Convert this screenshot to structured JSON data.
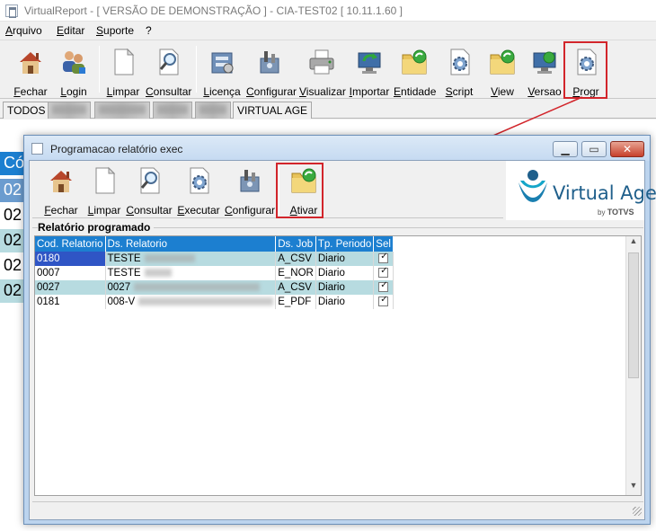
{
  "window": {
    "title": "VirtualReport - [ VERSÃO DE DEMONSTRAÇÃO ] - CIA-TEST02 [ 10.11.1.60 ]"
  },
  "menu": [
    "Arquivo",
    "Editar",
    "Suporte",
    "?"
  ],
  "toolbar": [
    {
      "label": "Fechar",
      "icon": "house-icon"
    },
    {
      "label": "Login",
      "icon": "users-icon"
    },
    {
      "label": "Limpar",
      "icon": "blank-page-icon"
    },
    {
      "label": "Consultar",
      "icon": "magnifier-page-icon"
    },
    {
      "label": "Licença",
      "icon": "license-icon"
    },
    {
      "label": "Configurar",
      "icon": "configure-icon"
    },
    {
      "label": "Visualizar",
      "icon": "printer-icon"
    },
    {
      "label": "Importar",
      "icon": "import-icon"
    },
    {
      "label": "Entidade",
      "icon": "folder-refresh-icon"
    },
    {
      "label": "Script",
      "icon": "gear-page-icon"
    },
    {
      "label": "View",
      "icon": "folder-refresh-icon"
    },
    {
      "label": "Versao",
      "icon": "monitor-refresh-icon"
    },
    {
      "label": "Progr",
      "icon": "gear-page-icon"
    }
  ],
  "tabs": [
    {
      "label": "TODOS",
      "blurred": false
    },
    {
      "label": "",
      "blurred": true
    },
    {
      "label": "",
      "blurred": true
    },
    {
      "label": "",
      "blurred": true
    },
    {
      "label": "",
      "blurred": true
    },
    {
      "label": "VIRTUAL AGE",
      "blurred": false
    }
  ],
  "background_rows": [
    {
      "text": "Có"
    },
    {
      "text": "02"
    },
    {
      "text": "02"
    },
    {
      "text": "02"
    },
    {
      "text": "02"
    },
    {
      "text": "02"
    }
  ],
  "dialog": {
    "title": "Programacao relatório exec",
    "toolbar": [
      {
        "label": "Fechar",
        "icon": "house-icon"
      },
      {
        "label": "Limpar",
        "icon": "blank-page-icon"
      },
      {
        "label": "Consultar",
        "icon": "magnifier-page-icon"
      },
      {
        "label": "Executar",
        "icon": "gear-page-icon"
      },
      {
        "label": "Configurar",
        "icon": "configure-icon"
      },
      {
        "label": "Ativar",
        "icon": "folder-refresh-icon"
      }
    ],
    "logo": {
      "name": "Virtual Age",
      "by": "by",
      "brand": "TOTVS"
    },
    "group_title": "Relatório programado",
    "table": {
      "columns": [
        "Cod. Relatorio",
        "Ds. Relatorio",
        "Ds. Job",
        "Tp. Periodo",
        "Sel"
      ],
      "rows": [
        {
          "cod": "0180",
          "ds": "TESTE",
          "job": "A_CSV",
          "periodo": "Diario",
          "sel": true
        },
        {
          "cod": "0007",
          "ds": "TESTE",
          "job": "E_NOR",
          "periodo": "Diario",
          "sel": true
        },
        {
          "cod": "0027",
          "ds": "0027",
          "job": "A_CSV",
          "periodo": "Diario",
          "sel": true
        },
        {
          "cod": "0181",
          "ds": "008-V",
          "job": "E_PDF",
          "periodo": "Diario",
          "sel": true
        }
      ]
    }
  },
  "colors": {
    "header_blue": "#1c7fd0",
    "row_alt": "#b7dbe0",
    "highlight_red": "#d2252b",
    "selected_cell": "#2f55c5",
    "logo_blue": "#1f5f8b"
  }
}
